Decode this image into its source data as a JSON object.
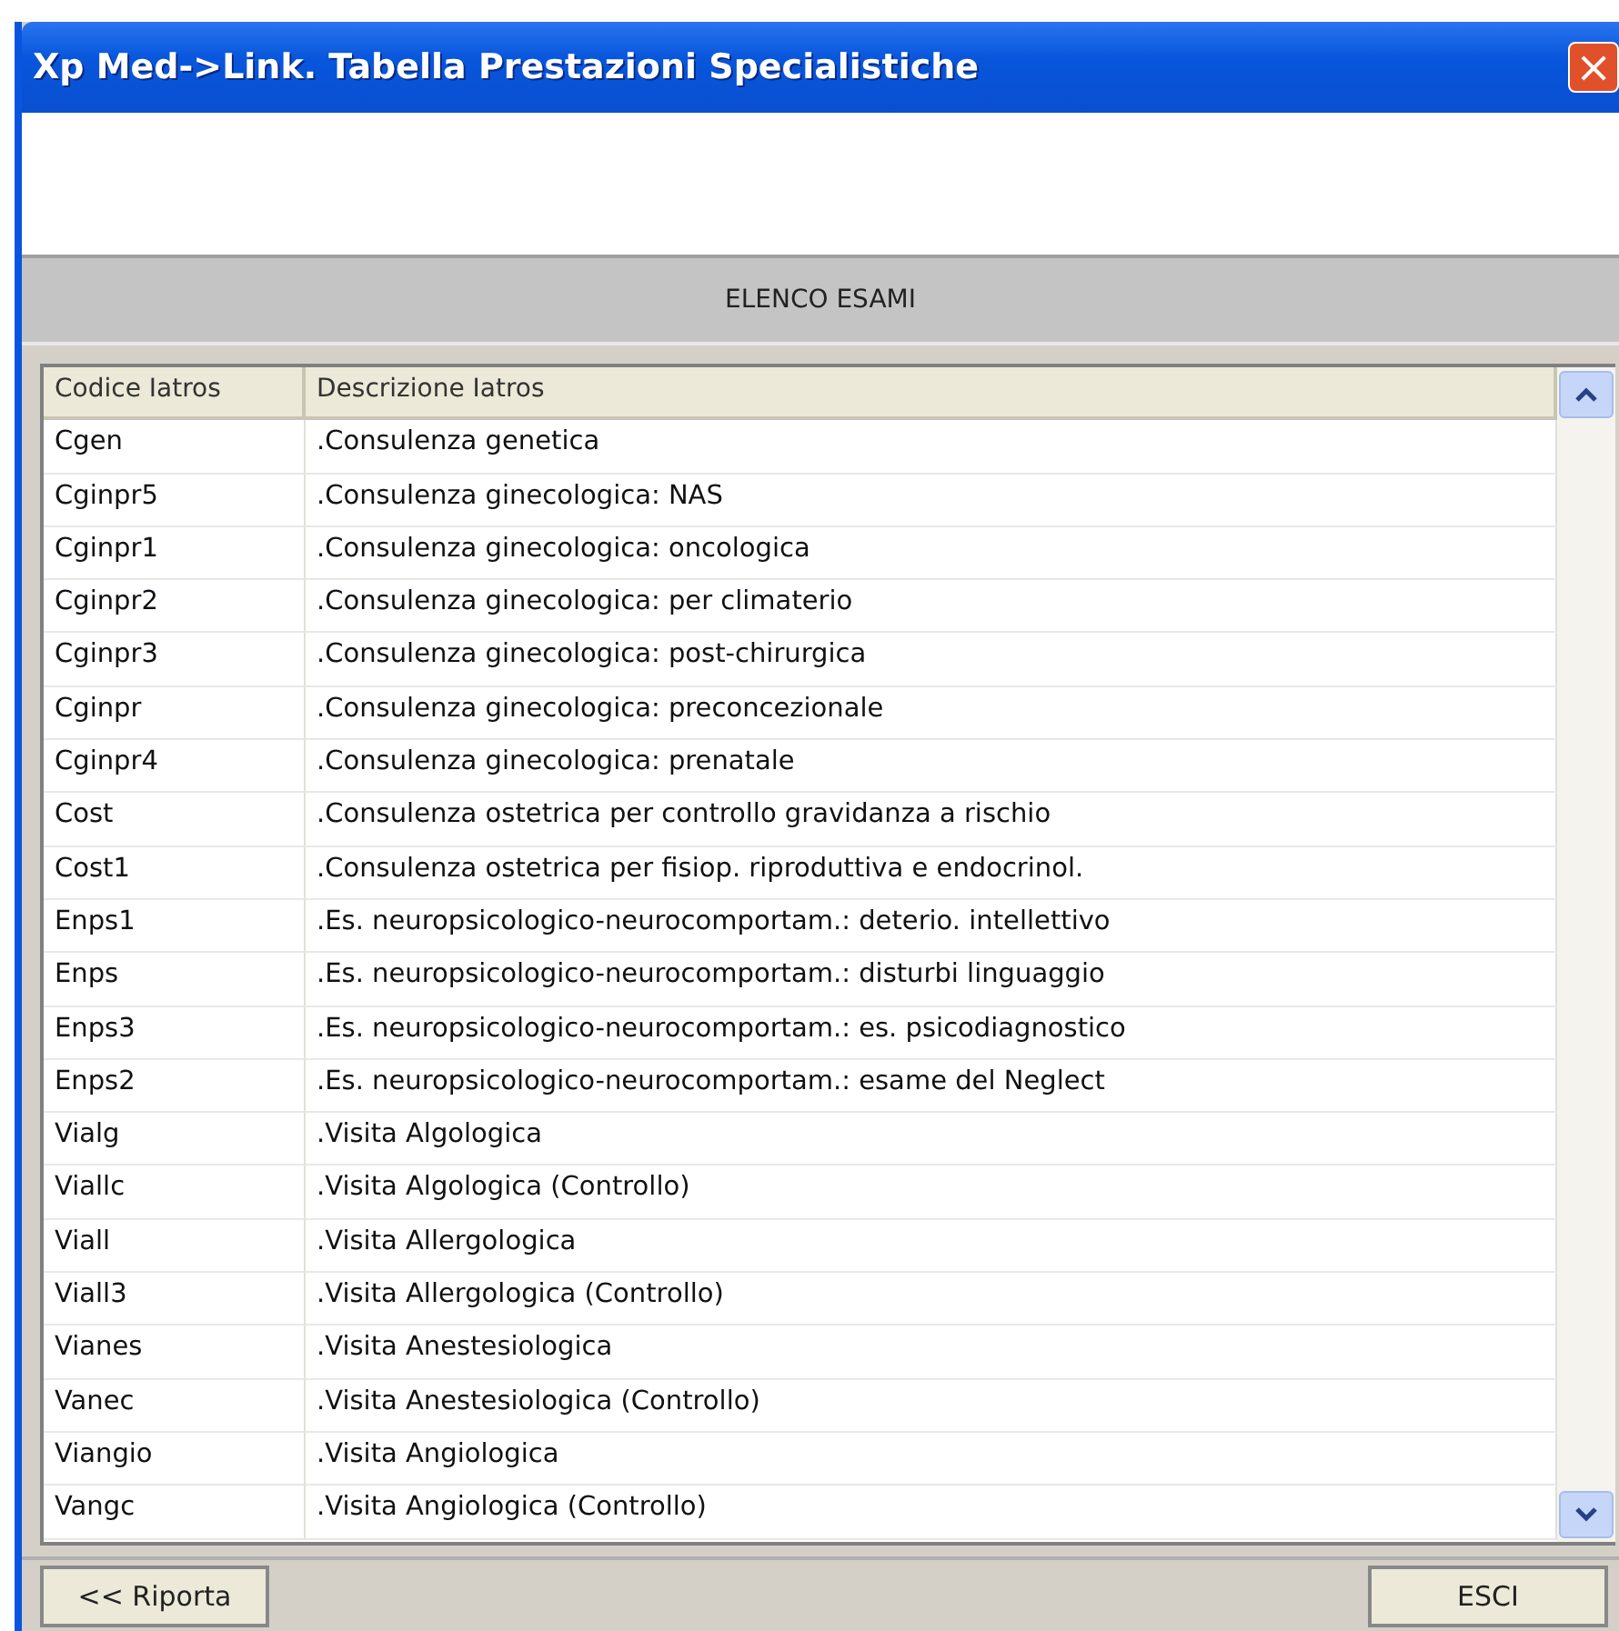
{
  "window": {
    "title": "Xp Med->Link. Tabella Prestazioni Specialistiche",
    "close": "×"
  },
  "section_title": "ELENCO ESAMI",
  "table": {
    "columns": [
      "Codice Iatros",
      "Descrizione Iatros"
    ],
    "rows": [
      [
        "Cgen",
        ".Consulenza genetica"
      ],
      [
        "Cginpr5",
        ".Consulenza ginecologica: NAS"
      ],
      [
        "Cginpr1",
        ".Consulenza ginecologica: oncologica"
      ],
      [
        "Cginpr2",
        ".Consulenza ginecologica: per climaterio"
      ],
      [
        "Cginpr3",
        ".Consulenza ginecologica: post-chirurgica"
      ],
      [
        "Cginpr",
        ".Consulenza ginecologica: preconcezionale"
      ],
      [
        "Cginpr4",
        ".Consulenza ginecologica: prenatale"
      ],
      [
        "Cost",
        ".Consulenza ostetrica per controllo gravidanza a rischio"
      ],
      [
        "Cost1",
        ".Consulenza ostetrica per fisiop. riproduttiva e endocrinol."
      ],
      [
        "Enps1",
        ".Es. neuropsicologico-neurocomportam.: deterio. intellettivo"
      ],
      [
        "Enps",
        ".Es. neuropsicologico-neurocomportam.: disturbi linguaggio"
      ],
      [
        "Enps3",
        ".Es. neuropsicologico-neurocomportam.: es. psicodiagnostico"
      ],
      [
        "Enps2",
        ".Es. neuropsicologico-neurocomportam.: esame del Neglect"
      ],
      [
        "Vialg",
        ".Visita Algologica"
      ],
      [
        "Viallc",
        ".Visita Algologica (Controllo)"
      ],
      [
        "Viall",
        ".Visita Allergologica"
      ],
      [
        "Viall3",
        ".Visita Allergologica (Controllo)"
      ],
      [
        "Vianes",
        ".Visita Anestesiologica"
      ],
      [
        "Vanec",
        ".Visita Anestesiologica (Controllo)"
      ],
      [
        "Viangio",
        ".Visita Angiologica"
      ],
      [
        "Vangc",
        ".Visita Angiologica (Controllo)"
      ]
    ]
  },
  "buttons": {
    "left": "<< Riporta",
    "right": "ESCI"
  }
}
